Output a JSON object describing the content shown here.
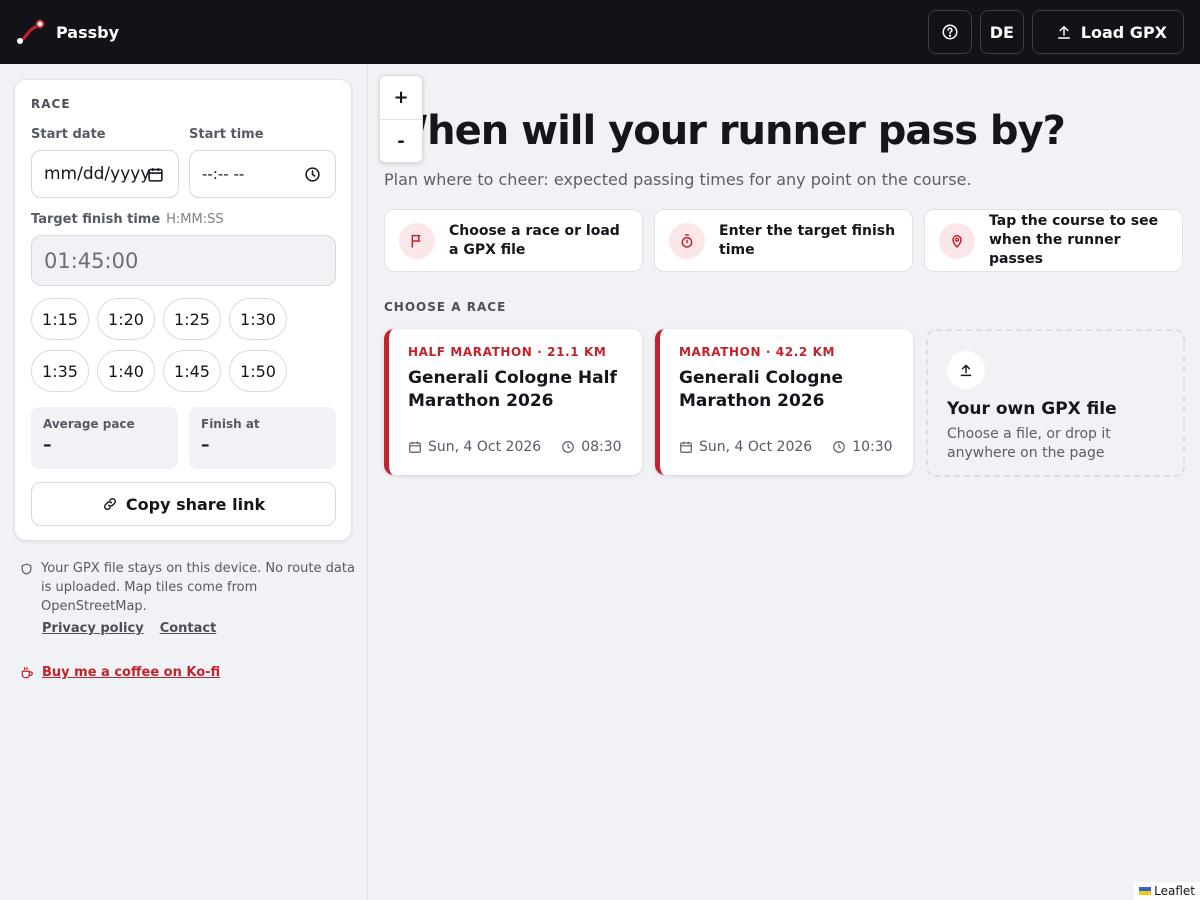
{
  "app": {
    "name": "Passby",
    "brand_color": "#c1222b",
    "help_icon": "help-circle-icon",
    "language_label": "DE",
    "load_gpx_label": "Load GPX"
  },
  "race_panel": {
    "title": "RACE",
    "start_date_label": "Start date",
    "start_date_value": "mm/dd/yyyy",
    "start_time_label": "Start time",
    "start_time_value": "--:-- --",
    "target_label": "Target finish time",
    "target_hint": "H:MM:SS",
    "target_value": "01:45:00",
    "chips": [
      "1:15",
      "1:20",
      "1:25",
      "1:30",
      "1:35",
      "1:40",
      "1:45",
      "1:50"
    ],
    "average_pace_label": "Average pace",
    "average_pace_value": "–",
    "finish_at_label": "Finish at",
    "finish_at_value": "–",
    "share_label": "Copy share link"
  },
  "footer": {
    "privacy_text": "Your GPX file stays on this device. No route data is uploaded. Map tiles come from OpenStreetMap.",
    "privacy_link": "Privacy policy",
    "contact_link": "Contact",
    "kofi_link": "Buy me a coffee on Ko-fi"
  },
  "map": {
    "zoom_in": "+",
    "zoom_out": "-",
    "attribution": "Leaflet"
  },
  "intro": {
    "heading": "When will your runner pass by?",
    "subheading": "Plan where to cheer: expected passing times for any point on the course.",
    "steps": [
      {
        "icon": "flag-icon",
        "text": "Choose a race or load a GPX file"
      },
      {
        "icon": "stopwatch-icon",
        "text": "Enter the target finish time"
      },
      {
        "icon": "map-pin-icon",
        "text": "Tap the course to see when the runner passes"
      }
    ]
  },
  "races": {
    "section_label": "CHOOSE A RACE",
    "items": [
      {
        "type": "HALF MARATHON · 21.1 KM",
        "name": "Generali Cologne Half Marathon 2026",
        "date": "Sun, 4 Oct 2026",
        "time": "08:30"
      },
      {
        "type": "MARATHON · 42.2 KM",
        "name": "Generali Cologne Marathon 2026",
        "date": "Sun, 4 Oct 2026",
        "time": "10:30"
      }
    ],
    "gpx_card": {
      "title": "Your own GPX file",
      "description": "Choose a file, or drop it anywhere on the page"
    }
  }
}
